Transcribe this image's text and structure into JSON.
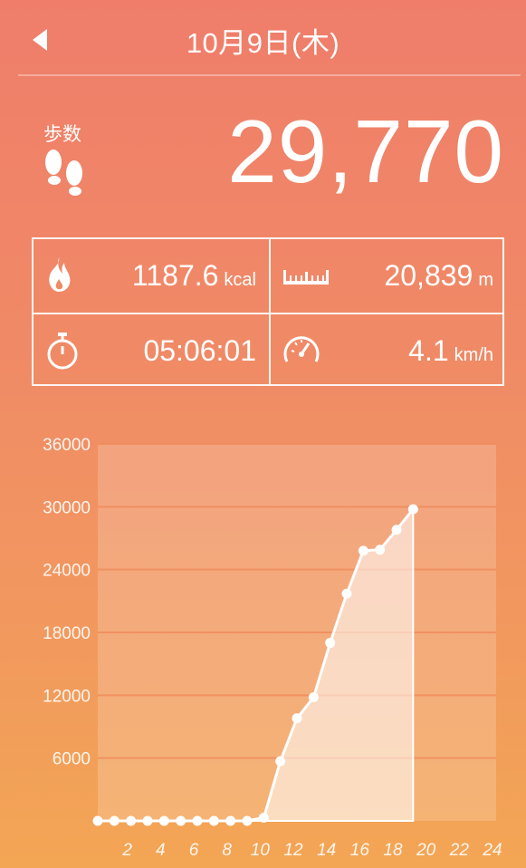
{
  "header": {
    "title": "10月9日(木)",
    "back_icon": "chevron-left-icon"
  },
  "steps": {
    "label": "歩数",
    "value": "29,770",
    "icon": "footprints-icon"
  },
  "stats": {
    "calories": {
      "value": "1187.6",
      "unit": "kcal",
      "icon": "flame-icon"
    },
    "distance": {
      "value": "20,839",
      "unit": "m",
      "icon": "ruler-icon"
    },
    "duration": {
      "value": "05:06:01",
      "icon": "stopwatch-icon"
    },
    "speed": {
      "value": "4.1",
      "unit": "km/h",
      "icon": "speedometer-icon"
    }
  },
  "colors": {
    "background_top": "#ef7d6a",
    "background_bottom": "#f3a654",
    "grid_line": "#f08a5a",
    "text": "#ffffff"
  },
  "chart_data": {
    "type": "area",
    "x": [
      0,
      1,
      2,
      3,
      4,
      5,
      6,
      7,
      8,
      9,
      10,
      11,
      12,
      13,
      14,
      15,
      16,
      17,
      18,
      19
    ],
    "values": [
      0,
      0,
      0,
      0,
      0,
      0,
      0,
      0,
      0,
      0,
      300,
      5700,
      9800,
      11800,
      17000,
      21700,
      25800,
      25900,
      27800,
      29770
    ],
    "x_ticks": [
      "2",
      "4",
      "6",
      "8",
      "10",
      "12",
      "14",
      "16",
      "18",
      "20",
      "22",
      "24"
    ],
    "y_ticks": [
      "6000",
      "12000",
      "18000",
      "24000",
      "30000",
      "36000"
    ],
    "xlim": [
      0,
      24
    ],
    "ylim": [
      0,
      36000
    ],
    "grid": true
  }
}
